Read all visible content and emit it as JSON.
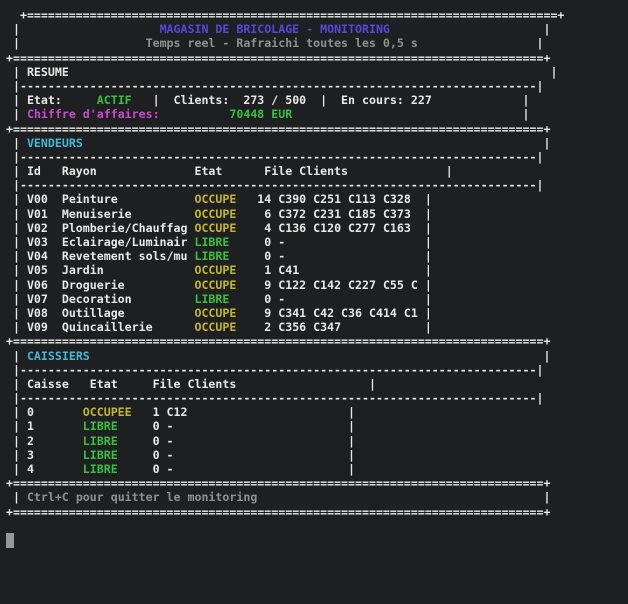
{
  "palette": {
    "background": "#1e1f21",
    "text": "#e9e9e7",
    "dim": "#8f9193",
    "title_purple": "#5847dd",
    "section_cyan": "#41b9d6",
    "green": "#35c23c",
    "yellow": "#c3b821",
    "magenta": "#cb4ad1",
    "cursor": "#979797"
  },
  "header": {
    "title": "MAGASIN DE BRICOLAGE - MONITORING",
    "subtitle": "Temps reel - Rafraichi toutes les 0,5 s"
  },
  "resume": {
    "label": "RESUME",
    "etat_label": "Etat:",
    "etat_value": "ACTIF",
    "clients_label": "Clients:",
    "clients_value": "273 / 500",
    "encours_label": "En cours:",
    "encours_value": "227",
    "ca_label": "Chiffre d'affaires:",
    "ca_value": "70448 EUR"
  },
  "vendeurs": {
    "label": "VENDEURS",
    "columns": [
      "Id",
      "Rayon",
      "Etat",
      "File Clients"
    ],
    "rows": [
      {
        "id": "V00",
        "rayon": "Peinture",
        "etat": "OCCUPE",
        "file": "14",
        "clients": "C390 C251 C113 C328"
      },
      {
        "id": "V01",
        "rayon": "Menuiserie",
        "etat": "OCCUPE",
        "file": "6",
        "clients": "C372 C231 C185 C373"
      },
      {
        "id": "V02",
        "rayon": "Plomberie/Chauffag",
        "etat": "OCCUPE",
        "file": "4",
        "clients": "C136 C120 C277 C163"
      },
      {
        "id": "V03",
        "rayon": "Eclairage/Luminair",
        "etat": "LIBRE",
        "file": "0",
        "clients": "-"
      },
      {
        "id": "V04",
        "rayon": "Revetement sols/mu",
        "etat": "LIBRE",
        "file": "0",
        "clients": "-"
      },
      {
        "id": "V05",
        "rayon": "Jardin",
        "etat": "OCCUPE",
        "file": "1",
        "clients": "C41"
      },
      {
        "id": "V06",
        "rayon": "Droguerie",
        "etat": "OCCUPE",
        "file": "9",
        "clients": "C122 C142 C227 C55 C"
      },
      {
        "id": "V07",
        "rayon": "Decoration",
        "etat": "LIBRE",
        "file": "0",
        "clients": "-"
      },
      {
        "id": "V08",
        "rayon": "Outillage",
        "etat": "OCCUPE",
        "file": "9",
        "clients": "C341 C42 C36 C414 C1"
      },
      {
        "id": "V09",
        "rayon": "Quincaillerie",
        "etat": "OCCUPE",
        "file": "2",
        "clients": "C356 C347"
      }
    ]
  },
  "caissiers": {
    "label": "CAISSIERS",
    "columns": [
      "Caisse",
      "Etat",
      "File Clients"
    ],
    "rows": [
      {
        "caisse": "0",
        "etat": "OCCUPEE",
        "file": "1",
        "clients": "C12"
      },
      {
        "caisse": "1",
        "etat": "LIBRE",
        "file": "0",
        "clients": "-"
      },
      {
        "caisse": "2",
        "etat": "LIBRE",
        "file": "0",
        "clients": "-"
      },
      {
        "caisse": "3",
        "etat": "LIBRE",
        "file": "0",
        "clients": "-"
      },
      {
        "caisse": "4",
        "etat": "LIBRE",
        "file": "0",
        "clients": "-"
      }
    ]
  },
  "footer": {
    "hint": "Ctrl+C pour quitter le monitoring"
  }
}
